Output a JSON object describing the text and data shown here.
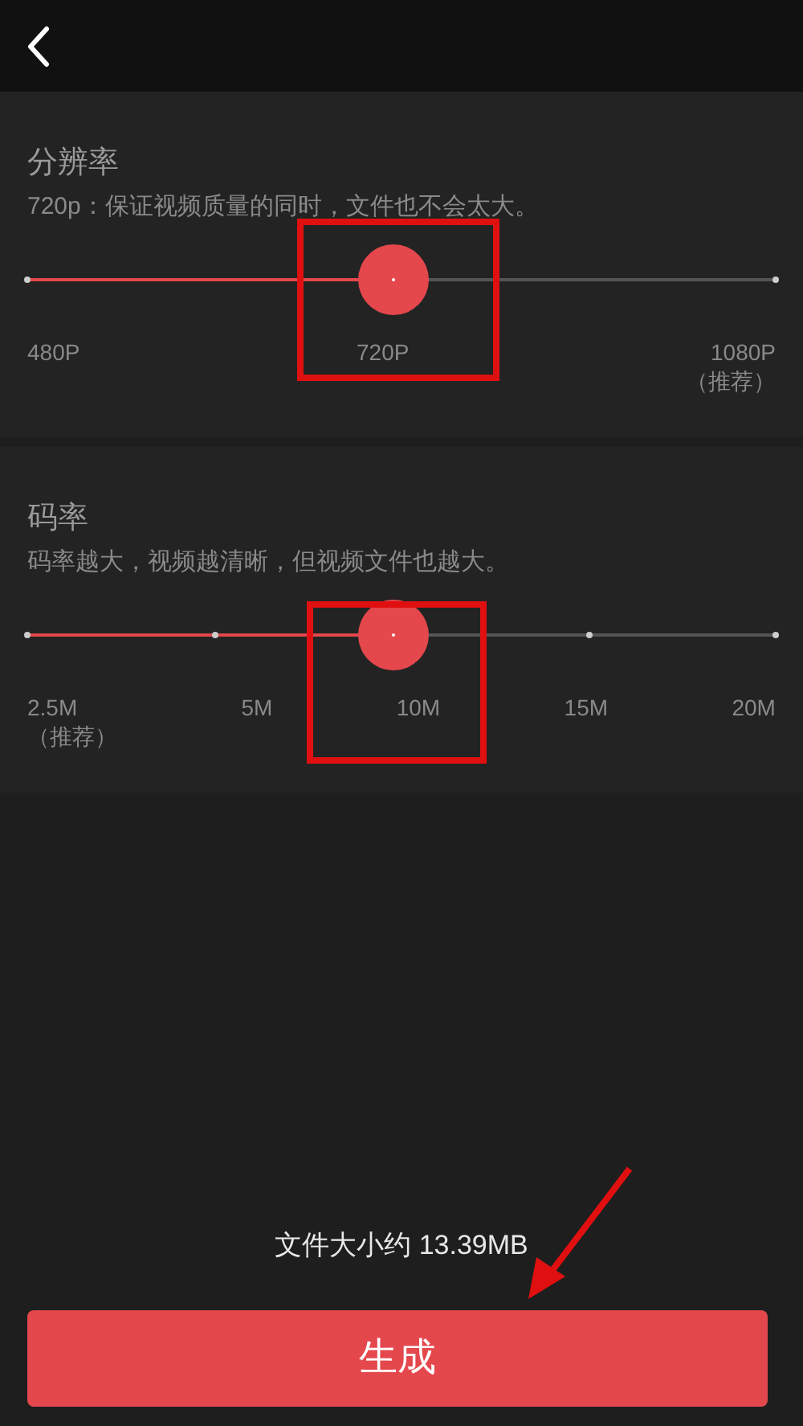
{
  "sections": [
    {
      "title": "分辨率",
      "description": "720p：保证视频质量的同时，文件也不会太大。",
      "level": 0.49,
      "stops": [
        {
          "label": "480P"
        },
        {
          "label": "720P"
        },
        {
          "label": "1080P",
          "note": "（推荐）"
        }
      ]
    },
    {
      "title": "码率",
      "description": "码率越大，视频越清晰，但视频文件也越大。",
      "level": 0.49,
      "stops": [
        {
          "label": "2.5M",
          "note": "（推荐）"
        },
        {
          "label": "5M"
        },
        {
          "label": "10M"
        },
        {
          "label": "15M"
        },
        {
          "label": "20M"
        }
      ]
    }
  ],
  "file_size": "文件大小约 13.39MB",
  "generate_button": "生成"
}
